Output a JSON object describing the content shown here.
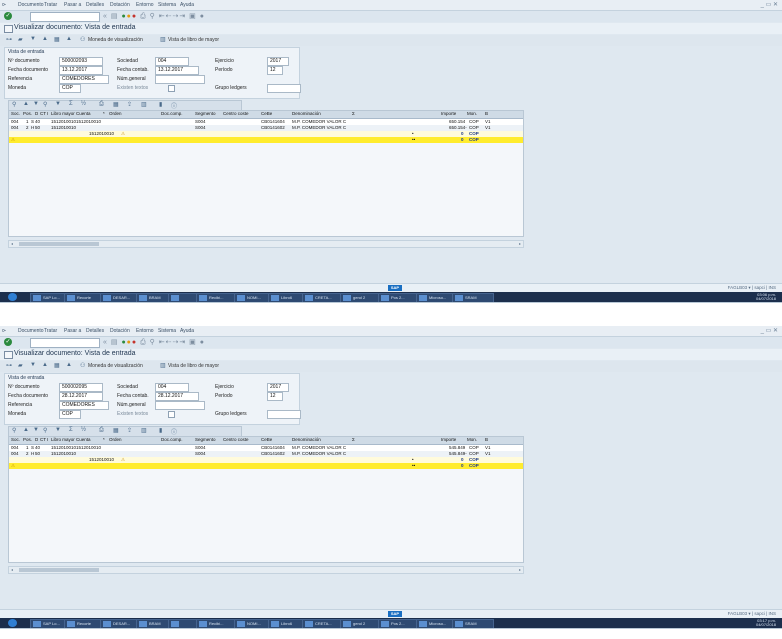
{
  "screens": [
    {
      "menu": [
        "Documento",
        "Tratar",
        "Pasar a",
        "Detalles",
        "Dotación",
        "Entorno",
        "Sistema",
        "Ayuda"
      ],
      "title": "Visualizar documento: Vista de entrada",
      "toolbar": {
        "moneda_btn": "Moneda de visualización",
        "ledger_btn": "Vista de libro de mayor"
      },
      "header": {
        "section": "Vista de entrada",
        "labels": {
          "doc_no": "Nº documento",
          "doc_date": "Fecha documento",
          "reference": "Referencia",
          "currency": "Moneda",
          "company": "Sociedad",
          "posting_date": "Fecha contab.",
          "cross_doc": "Núm.general",
          "texts": "Existen textos",
          "fiscal_year": "Ejercicio",
          "period": "Período",
          "ledger_group": "Grupo ledgers"
        },
        "values": {
          "doc_no": "500002093",
          "doc_date": "13.12.2017",
          "reference": "COMEDORES",
          "currency": "COP",
          "company": "004",
          "posting_date": "13.12.2017",
          "fiscal_year": "2017",
          "period": "12"
        }
      },
      "columns": [
        "Soc.",
        "Pos.",
        "D",
        "CT",
        "I",
        "Libro mayor",
        "Cuenta",
        "*",
        "Orden",
        "Doc.comp.",
        "Segmento",
        "Centro coste",
        "CeBe",
        "Denominación",
        "Σ",
        "Importe",
        "Mon.",
        "B"
      ],
      "rows": [
        {
          "soc": "004",
          "pos": "1",
          "d": "S",
          "ct": "40",
          "ledger": "1512010010",
          "account": "1512010010",
          "segment": "S004",
          "cebe": "CB0141604",
          "denom": "M.P. COMEDOR VALOR C",
          "amount": "650.154",
          "cur": "COP",
          "b": "V1"
        },
        {
          "soc": "004",
          "pos": "2",
          "d": "H",
          "ct": "50",
          "ledger": "1512010010",
          "account": "",
          "segment": "S004",
          "cebe": "CB0141602",
          "denom": "M.P. COMEDOR VALOR C",
          "amount": "650.154-",
          "cur": "COP",
          "b": "V1"
        }
      ],
      "subtotal": {
        "ledger": "1512010010",
        "sym": "•",
        "amount": "0",
        "cur": "COP"
      },
      "total": {
        "sym": "••",
        "amount": "0",
        "cur": "COP"
      },
      "status_right": "FAGLB03 ▾ | sapci | INS",
      "clock": {
        "time": "03:06 p.m.",
        "date": "04/07/2018"
      }
    },
    {
      "menu": [
        "Documento",
        "Tratar",
        "Pasar a",
        "Detalles",
        "Dotación",
        "Entorno",
        "Sistema",
        "Ayuda"
      ],
      "title": "Visualizar documento: Vista de entrada",
      "toolbar": {
        "moneda_btn": "Moneda de visualización",
        "ledger_btn": "Vista de libro de mayor"
      },
      "header": {
        "section": "Vista de entrada",
        "labels": {
          "doc_no": "Nº documento",
          "doc_date": "Fecha documento",
          "reference": "Referencia",
          "currency": "Moneda",
          "company": "Sociedad",
          "posting_date": "Fecha contab.",
          "cross_doc": "Núm.general",
          "texts": "Existen textos",
          "fiscal_year": "Ejercicio",
          "period": "Período",
          "ledger_group": "Grupo ledgers"
        },
        "values": {
          "doc_no": "500002095",
          "doc_date": "28.12.2017",
          "reference": "COMEDORES",
          "currency": "COP",
          "company": "004",
          "posting_date": "28.12.2017",
          "fiscal_year": "2017",
          "period": "12"
        }
      },
      "columns": [
        "Soc.",
        "Pos.",
        "D",
        "CT",
        "I",
        "Libro mayor",
        "Cuenta",
        "*",
        "Orden",
        "Doc.comp.",
        "Segmento",
        "Centro coste",
        "CeBe",
        "Denominación",
        "Σ",
        "Importe",
        "Mon.",
        "B"
      ],
      "rows": [
        {
          "soc": "004",
          "pos": "1",
          "d": "S",
          "ct": "40",
          "ledger": "1512010010",
          "account": "1512010010",
          "segment": "S004",
          "cebe": "CB0141604",
          "denom": "M.P. COMEDOR VALOR C",
          "amount": "545.849",
          "cur": "COP",
          "b": "V1"
        },
        {
          "soc": "004",
          "pos": "2",
          "d": "H",
          "ct": "50",
          "ledger": "1512010010",
          "account": "",
          "segment": "S004",
          "cebe": "CB0141602",
          "denom": "M.P. COMEDOR VALOR C",
          "amount": "545.849-",
          "cur": "COP",
          "b": "V1"
        }
      ],
      "subtotal": {
        "ledger": "1512010010",
        "sym": "•",
        "amount": "0",
        "cur": "COP"
      },
      "total": {
        "sym": "••",
        "amount": "0",
        "cur": "COP"
      },
      "status_right": "FAGLB03 ▾ | sapci | INS",
      "clock": {
        "time": "03:17 p.m.",
        "date": "04/07/2018"
      }
    }
  ],
  "taskbar": [
    "SAP Lo...",
    "Recorte",
    "DESAR...",
    "BRAM",
    "",
    "Recibi...",
    "NOMI...",
    "Libro6",
    "CRETA...",
    "gerol 2",
    "Pos 2...",
    "Microso...",
    "SRAM"
  ]
}
